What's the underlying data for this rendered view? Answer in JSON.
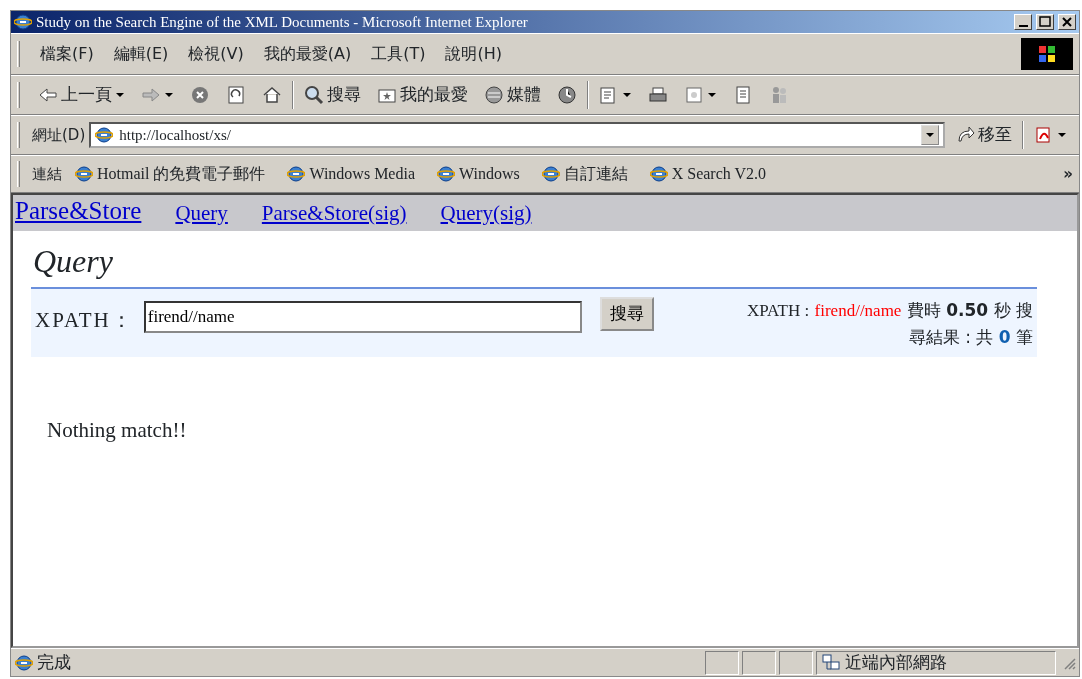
{
  "window": {
    "title": "Study on the Search Engine of the XML Documents - Microsoft Internet Explorer"
  },
  "menu": [
    "檔案(F)",
    "編輯(E)",
    "檢視(V)",
    "我的最愛(A)",
    "工具(T)",
    "說明(H)"
  ],
  "toolbar": [
    {
      "kind": "back",
      "label": "上一頁"
    },
    {
      "kind": "forward"
    },
    {
      "kind": "stop"
    },
    {
      "kind": "refresh"
    },
    {
      "kind": "home"
    },
    {
      "kind": "sep"
    },
    {
      "kind": "search",
      "label": "搜尋"
    },
    {
      "kind": "favorites",
      "label": "我的最愛"
    },
    {
      "kind": "media",
      "label": "媒體"
    },
    {
      "kind": "history"
    },
    {
      "kind": "sep"
    },
    {
      "kind": "mail"
    },
    {
      "kind": "print"
    },
    {
      "kind": "edit"
    },
    {
      "kind": "discuss"
    },
    {
      "kind": "messenger"
    }
  ],
  "address": {
    "label": "網址(D)",
    "url": "http://localhost/xs/",
    "go": "移至"
  },
  "links": {
    "label": "連結",
    "items": [
      "Hotmail 的免費電子郵件",
      "Windows Media",
      "Windows",
      "自訂連結",
      "X Search V2.0"
    ],
    "more": "»"
  },
  "page": {
    "nav": [
      {
        "label": "Parse&Store",
        "selected": true
      },
      {
        "label": "Query",
        "selected": false
      },
      {
        "label": "Parse&Store(sig)",
        "selected": false
      },
      {
        "label": "Query(sig)",
        "selected": false
      }
    ],
    "heading": "Query",
    "form": {
      "label": "XPATH：",
      "value": "firend//name",
      "button": "搜尋"
    },
    "result": [
      [
        {
          "kind": "label",
          "text": "XPATH :"
        },
        {
          "kind": "query",
          "text": "firend//name"
        },
        {
          "kind": "plain",
          "text": "費時"
        },
        {
          "kind": "bold",
          "text": "0.50"
        },
        {
          "kind": "plain",
          "text": "秒 搜"
        }
      ],
      [
        {
          "kind": "plain",
          "text": "尋結果 : 共"
        },
        {
          "kind": "count",
          "text": "0"
        },
        {
          "kind": "plain",
          "text": "筆"
        }
      ]
    ],
    "message": "Nothing match!!"
  },
  "status_bar": {
    "text": "完成",
    "zone": "近端內部網路"
  }
}
